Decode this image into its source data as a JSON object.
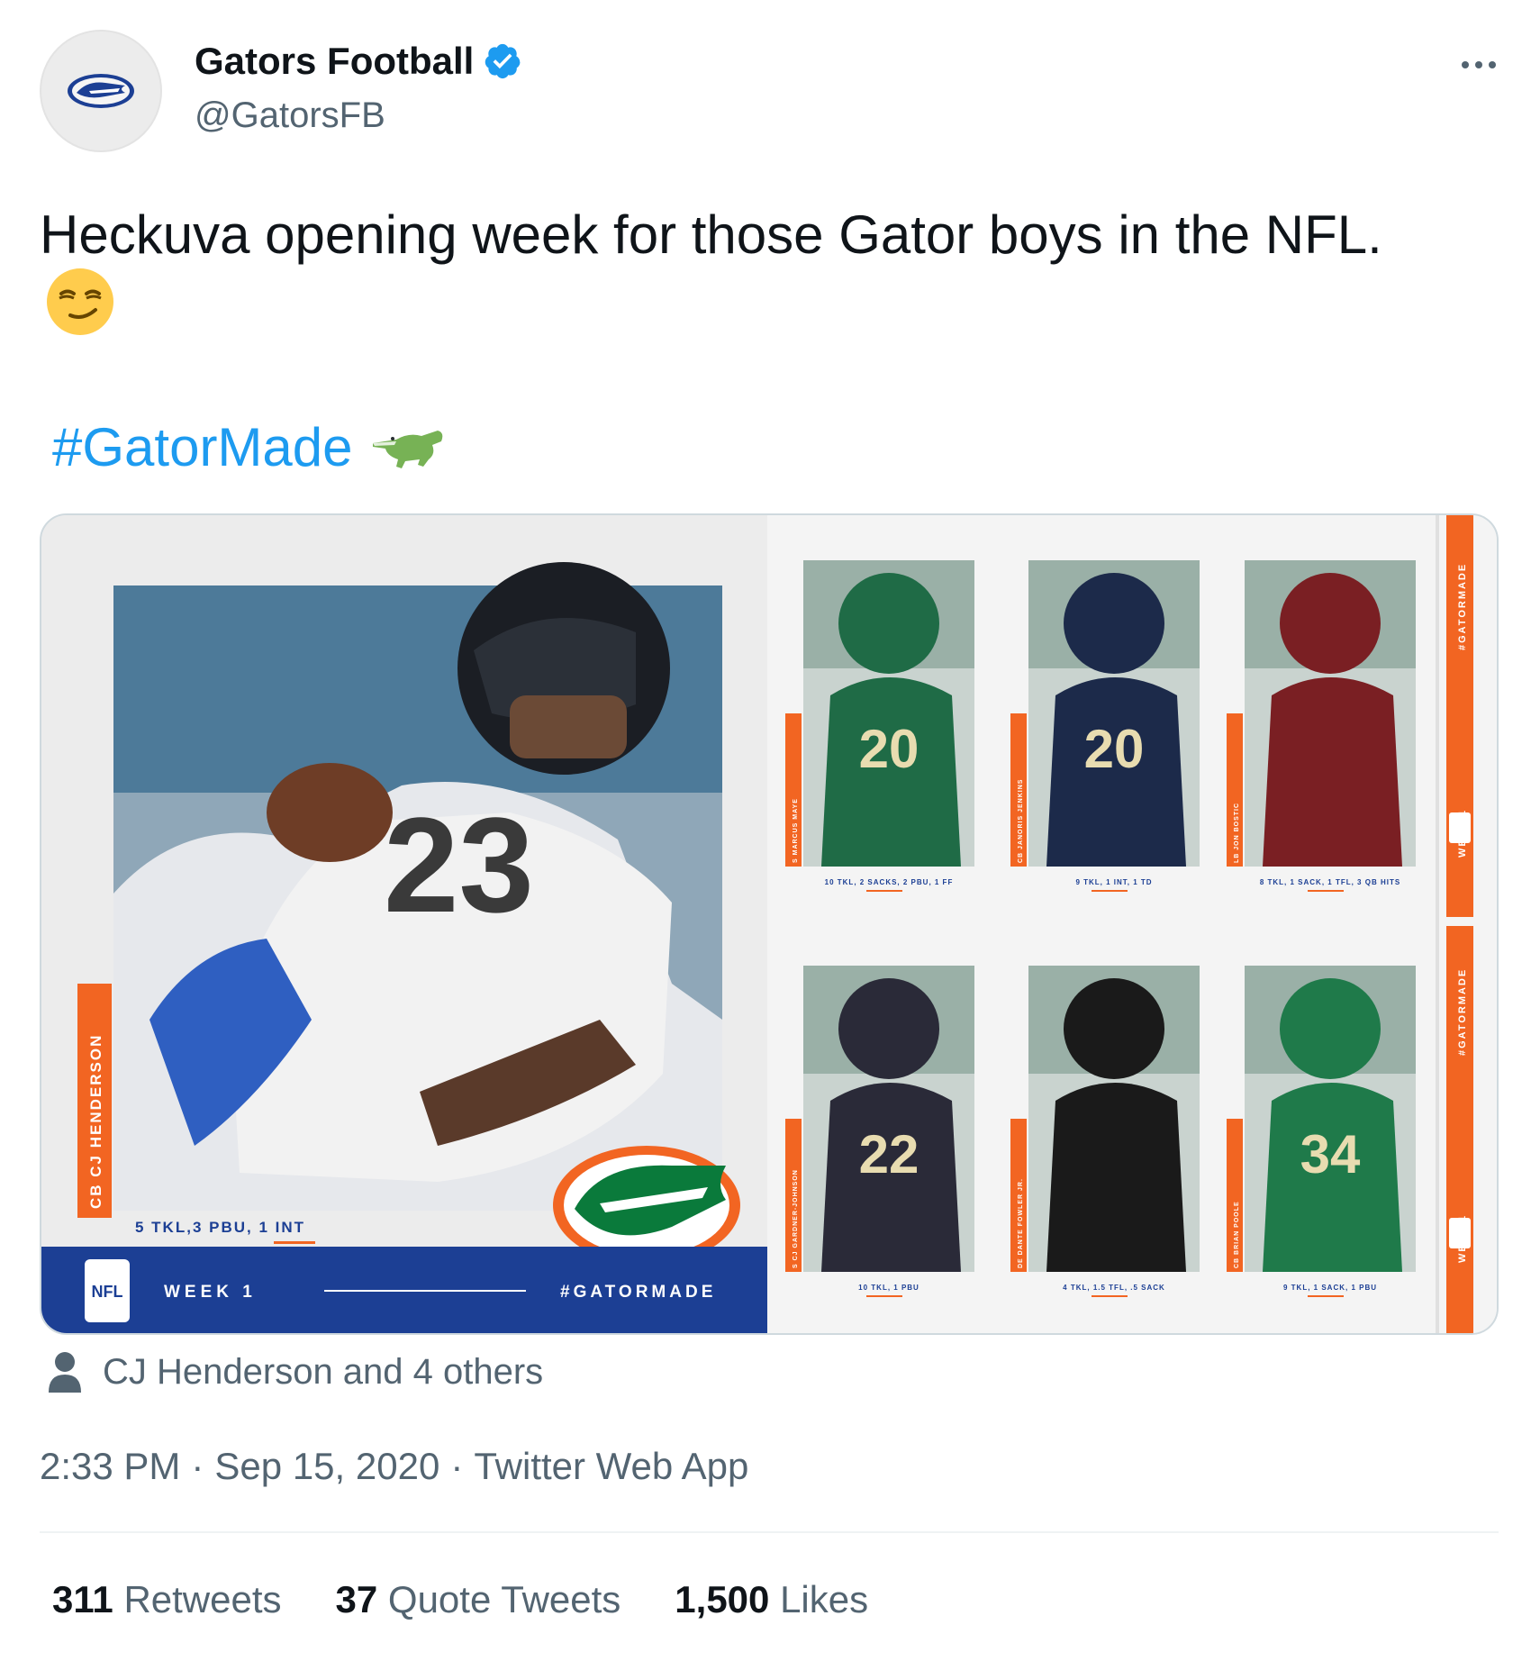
{
  "author": {
    "display_name": "Gators Football",
    "handle": "@GatorsFB",
    "verified_icon": "verified-badge-icon",
    "avatar_icon": "gator-logo-icon"
  },
  "tweet": {
    "text": "Heckuva opening week for those Gator boys in the NFL.",
    "emoji": "smirking-face-emoji",
    "hashtag": "#GatorMade",
    "hashtag_emoji": "crocodile-emoji"
  },
  "media": {
    "featured": {
      "position_name": "CB CJ HENDERSON",
      "stats": "5 TKL,3 PBU, 1 INT",
      "week": "WEEK 1",
      "tag": "#GATORMADE",
      "league": "NFL",
      "jersey": "23"
    },
    "side_tag": "#GATORMADE",
    "side_week": "WEEK 1",
    "players": [
      {
        "label": "S MARCUS MAYE",
        "stats": "10 TKL, 2 SACKS, 2 PBU, 1 FF",
        "jersey": "20",
        "color": "#1f6b46"
      },
      {
        "label": "CB JANORIS JENKINS",
        "stats": "9 TKL, 1 INT, 1 TD",
        "jersey": "20",
        "color": "#1c2a4a"
      },
      {
        "label": "LB JON BOSTIC",
        "stats": "8 TKL, 1 SACK, 1 TFL, 3 QB HITS",
        "jersey": "",
        "color": "#7a1f23"
      },
      {
        "label": "S CJ GARDNER-JOHNSON",
        "stats": "10 TKL, 1 PBU",
        "jersey": "22",
        "color": "#2a2a38"
      },
      {
        "label": "DE DANTE FOWLER JR.",
        "stats": "4 TKL, 1.5 TFL, .5 SACK",
        "jersey": "",
        "color": "#1a1a1a"
      },
      {
        "label": "CB BRIAN POOLE",
        "stats": "9 TKL, 1 SACK, 1 PBU",
        "jersey": "34",
        "color": "#1f7a4a"
      }
    ],
    "colors": {
      "orange": "#f26522",
      "blue": "#1c3f94",
      "green": "#0a7a3b"
    }
  },
  "tagged": {
    "icon": "person-icon",
    "text": "CJ Henderson and 4 others"
  },
  "meta": {
    "time": "2:33 PM",
    "date": "Sep 15, 2020",
    "source": "Twitter Web App",
    "sep": "·"
  },
  "stats": {
    "retweets_count": "311",
    "retweets_label": "Retweets",
    "quotes_count": "37",
    "quotes_label": "Quote Tweets",
    "likes_count": "1,500",
    "likes_label": "Likes"
  }
}
